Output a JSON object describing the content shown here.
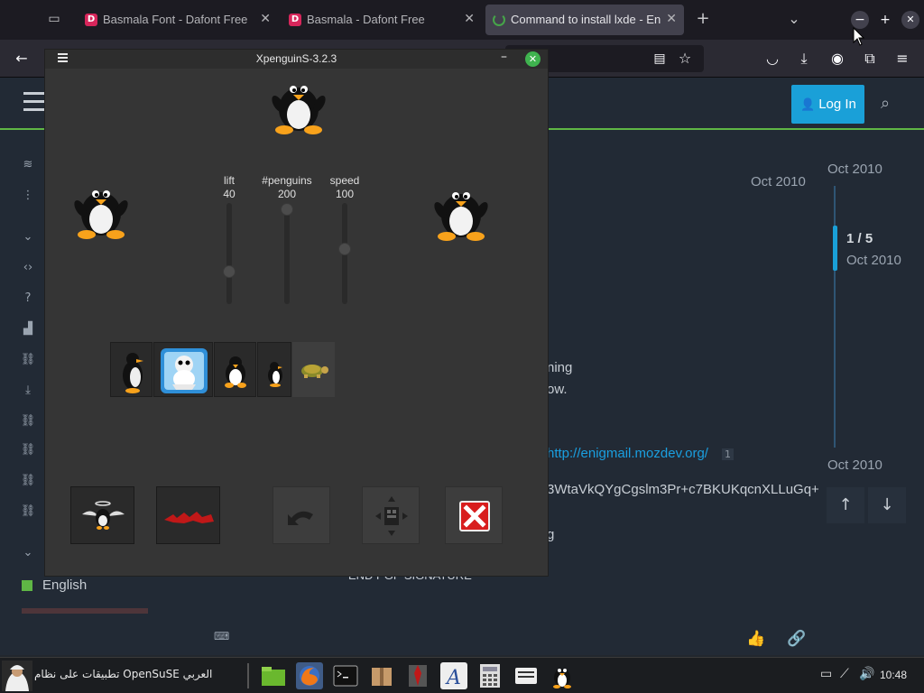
{
  "browser": {
    "tabs": [
      {
        "title": "Basmala Font - Dafont Free",
        "favicon": "D",
        "active": false
      },
      {
        "title": "Basmala - Dafont Free",
        "favicon": "D",
        "active": false
      },
      {
        "title": "Command to install lxde - Engli",
        "favicon": "opensuse-icon",
        "active": true
      }
    ],
    "new_tab_label": "+",
    "list_tabs_label": "⌄"
  },
  "page": {
    "login_label": "Log In",
    "dates": {
      "post_date": "Oct 2010",
      "timeline_top": "Oct 2010",
      "timeline_current": "Oct 2010",
      "timeline_bottom": "Oct 2010"
    },
    "progress": "1 / 5",
    "body_lines": [
      "ning",
      "ow.",
      "3WtaVkQYgCgslm3Pr+c7BKUKqcnXLLuGq+",
      "g",
      "END PGP SIGNATURE"
    ],
    "link_text": "http://enigmail.mozdev.org/",
    "link_footnote": "1",
    "language": "English"
  },
  "xpenguins": {
    "title": "XpenguinS-3.2.3",
    "sliders": [
      {
        "label": "lift",
        "value": "40",
        "fraction": 0.3
      },
      {
        "label": "#penguins",
        "value": "200",
        "fraction": 1.0
      },
      {
        "label": "speed",
        "value": "100",
        "fraction": 0.55
      }
    ],
    "themes": [
      "penguins",
      "big-penguins",
      "tux",
      "small-penguins",
      "turtles"
    ]
  },
  "taskbar": {
    "menu_label": "تطبيقات على نظام OpenSuSE العربي",
    "clock": "10:48"
  }
}
